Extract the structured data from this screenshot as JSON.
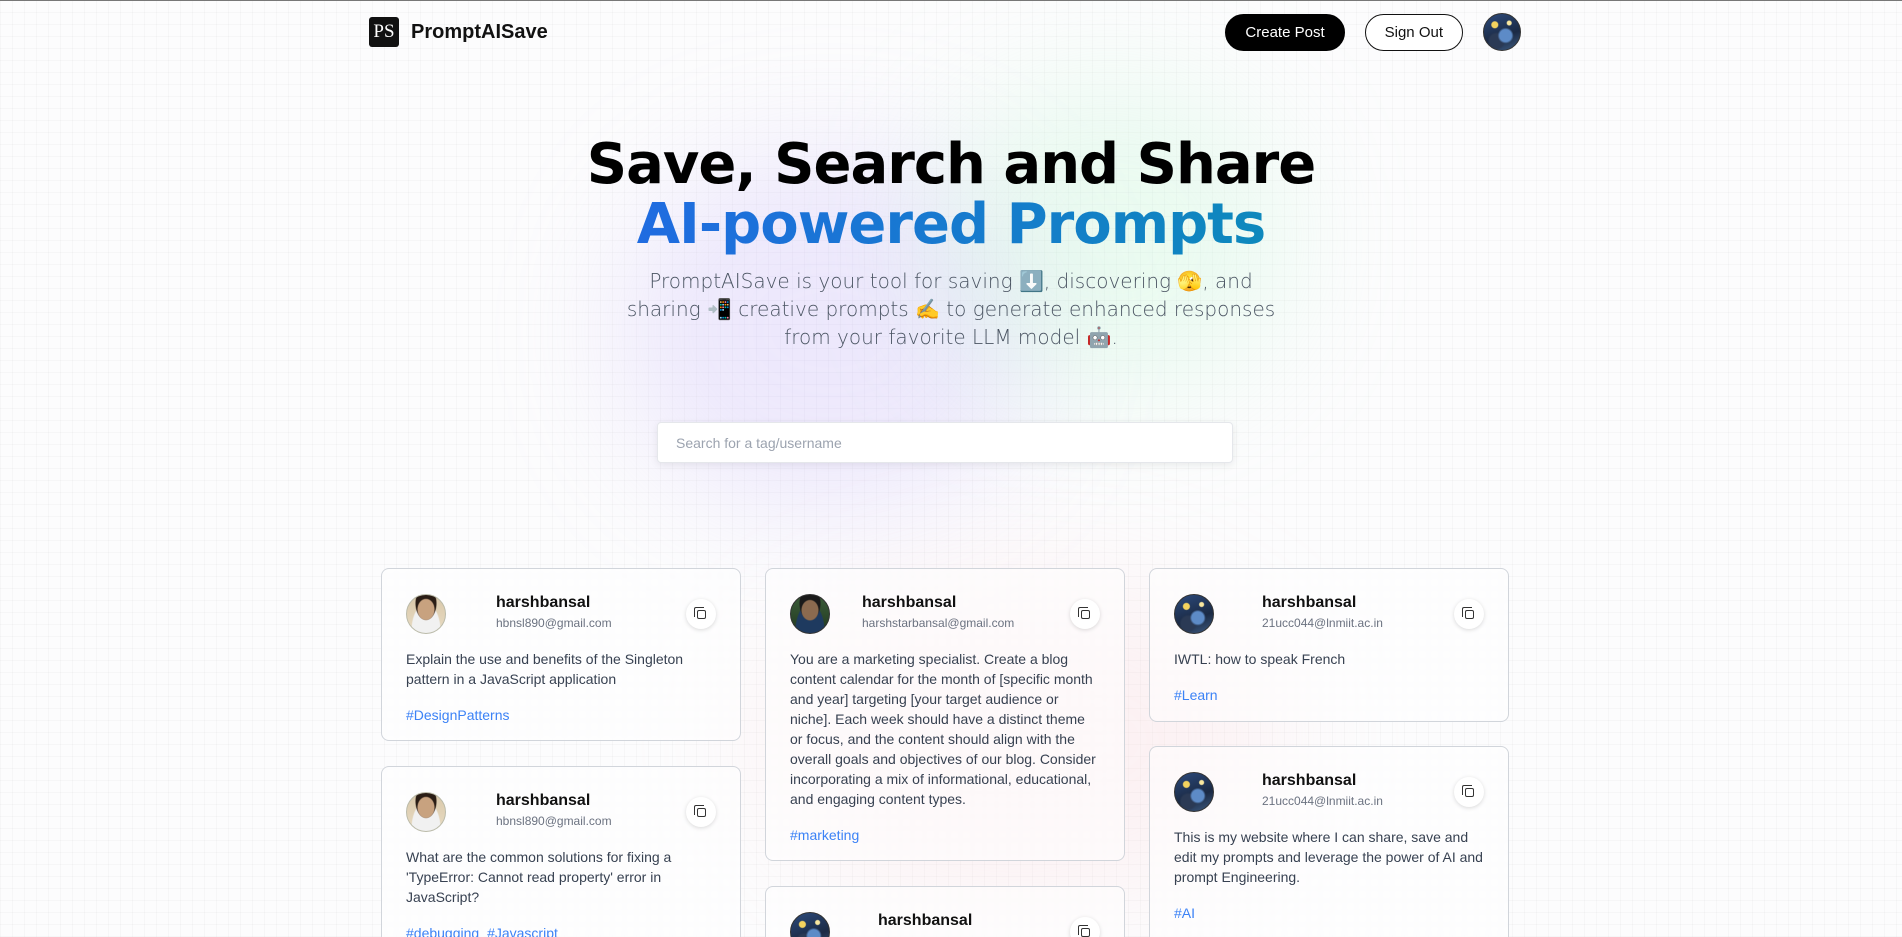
{
  "nav": {
    "brand_logo_text": "PS",
    "brand_name": "PromptAISave",
    "create_post": "Create Post",
    "sign_out": "Sign Out",
    "avatar_icon": "user-avatar-starry-night"
  },
  "hero": {
    "title_line1": "Save, Search and Share",
    "title_line2": "AI-powered Prompts",
    "description": "PromptAISave is your tool for saving ⬇️, discovering 🫣, and sharing 📲 creative prompts ✍️ to generate enhanced responses from your favorite LLM model 🤖."
  },
  "search": {
    "placeholder": "Search for a tag/username",
    "value": ""
  },
  "cards": [
    {
      "username": "harshbansal",
      "email": "hbnsl890@gmail.com",
      "prompt": "Explain the use and benefits of the Singleton pattern in a JavaScript application",
      "tags": [
        "#DesignPatterns"
      ]
    },
    {
      "username": "harshbansal",
      "email": "hbnsl890@gmail.com",
      "prompt": "What are the common solutions for fixing a 'TypeError: Cannot read property' error in JavaScript?",
      "tags": [
        "#debugging",
        "#Javascript"
      ]
    },
    {
      "username": "harshbansal",
      "email": "harshstarbansal@gmail.com",
      "prompt": "You are a marketing specialist. Create a blog content calendar for the month of [specific month and year] targeting [your target audience or niche]. Each week should have a distinct theme or focus, and the content should align with the overall goals and objectives of our blog. Consider incorporating a mix of informational, educational, and engaging content types.",
      "tags": [
        "#marketing"
      ]
    },
    {
      "username": "harshbansal",
      "email": "",
      "prompt": "",
      "tags": []
    },
    {
      "username": "harshbansal",
      "email": "21ucc044@lnmiit.ac.in",
      "prompt": "IWTL: how to speak French",
      "tags": [
        "#Learn"
      ]
    },
    {
      "username": "harshbansal",
      "email": "21ucc044@lnmiit.ac.in",
      "prompt": "This is my website where I can share, save and edit my prompts and leverage the power of AI and prompt Engineering.",
      "tags": [
        "#AI"
      ]
    }
  ],
  "colors": {
    "accent_gradient_start": "#2563eb",
    "accent_gradient_end": "#0891b2",
    "tag_blue": "#3b82f6",
    "button_black": "#000000"
  }
}
